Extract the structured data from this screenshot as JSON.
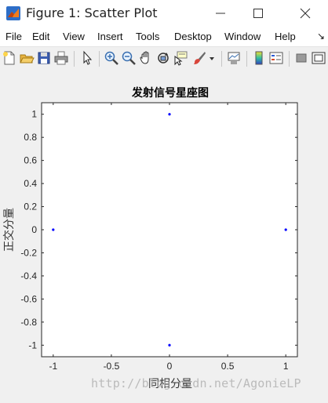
{
  "window": {
    "title": "Figure 1: Scatter Plot"
  },
  "menu": [
    "File",
    "Edit",
    "View",
    "Insert",
    "Tools",
    "Desktop",
    "Window",
    "Help"
  ],
  "toolbar": {
    "icons": [
      "new-figure-icon",
      "open-file-icon",
      "save-icon",
      "print-icon",
      "pointer-icon",
      "zoom-in-icon",
      "zoom-out-icon",
      "pan-icon",
      "rotate-3d-icon",
      "data-cursor-icon",
      "brush-icon",
      "brush-dropdown-icon",
      "link-plot-icon",
      "insert-colorbar-icon",
      "insert-legend-icon",
      "hide-plot-tools-icon",
      "show-plot-tools-icon"
    ],
    "more_indicator": "↘"
  },
  "chart_data": {
    "type": "scatter",
    "title": "发射信号星座图",
    "xlabel": "同相分量",
    "ylabel": "正交分量",
    "xlim": [
      -1.1,
      1.1
    ],
    "ylim": [
      -1.1,
      1.1
    ],
    "xticks": [
      -1,
      -0.5,
      0,
      0.5,
      1
    ],
    "xtick_labels": [
      "-1",
      "-0.5",
      "0",
      "0.5",
      "1"
    ],
    "yticks": [
      -1,
      -0.8,
      -0.6,
      -0.4,
      -0.2,
      0,
      0.2,
      0.4,
      0.6,
      0.8,
      1
    ],
    "ytick_labels": [
      "-1",
      "-0.8",
      "-0.6",
      "-0.4",
      "-0.2",
      "0",
      "0.2",
      "0.4",
      "0.6",
      "0.8",
      "1"
    ],
    "grid": false,
    "points": [
      {
        "x": 1,
        "y": 0
      },
      {
        "x": 0,
        "y": 1
      },
      {
        "x": -1,
        "y": 0
      },
      {
        "x": 0,
        "y": -1
      }
    ],
    "marker_color": "#0000ff"
  },
  "watermark": "http://blog.csdn.net/AgonieLP"
}
